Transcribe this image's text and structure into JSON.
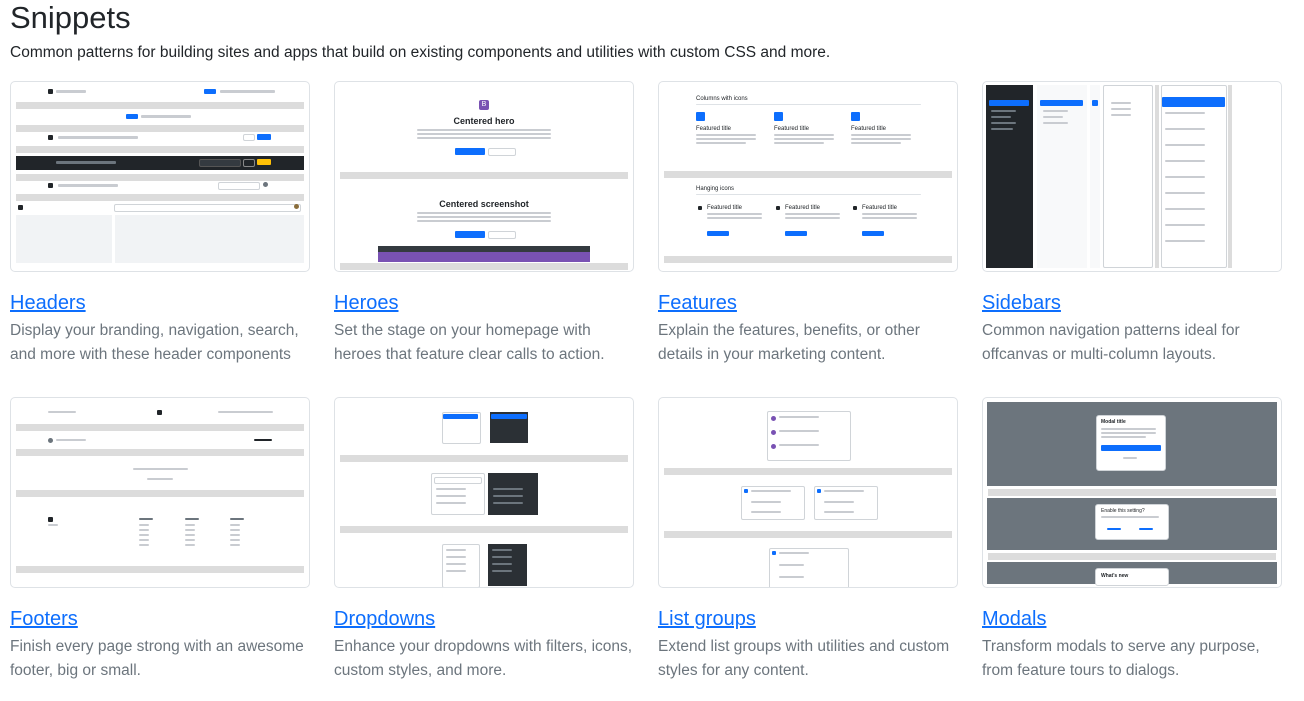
{
  "header": {
    "title": "Snippets",
    "lead": "Common patterns for building sites and apps that build on existing components and utilities with custom CSS and more."
  },
  "cards": [
    {
      "title": "Headers",
      "description": "Display your branding, navigation, search, and more with these header components"
    },
    {
      "title": "Heroes",
      "description": "Set the stage on your homepage with heroes that feature clear calls to action."
    },
    {
      "title": "Features",
      "description": "Explain the features, benefits, or other details in your marketing content."
    },
    {
      "title": "Sidebars",
      "description": "Common navigation patterns ideal for offcanvas or multi-column layouts."
    },
    {
      "title": "Footers",
      "description": "Finish every page strong with an awesome footer, big or small."
    },
    {
      "title": "Dropdowns",
      "description": "Enhance your dropdowns with filters, icons, custom styles, and more."
    },
    {
      "title": "List groups",
      "description": "Extend list groups with utilities and custom styles for any content."
    },
    {
      "title": "Modals",
      "description": "Transform modals to serve any purpose, from feature tours to dialogs."
    }
  ],
  "thumbs": {
    "heroes": {
      "hero_title": "Centered hero",
      "screenshot_title": "Centered screenshot"
    },
    "features": {
      "section1": "Columns with icons",
      "section2": "Hanging icons",
      "item": "Featured title"
    },
    "modals": {
      "modal_title": "Modal title",
      "modal2_title": "Enable this setting?",
      "modal3_title": "What's new"
    }
  },
  "colors": {
    "link": "#0d6efd",
    "muted": "#6c757d",
    "border": "#dee2e6"
  }
}
